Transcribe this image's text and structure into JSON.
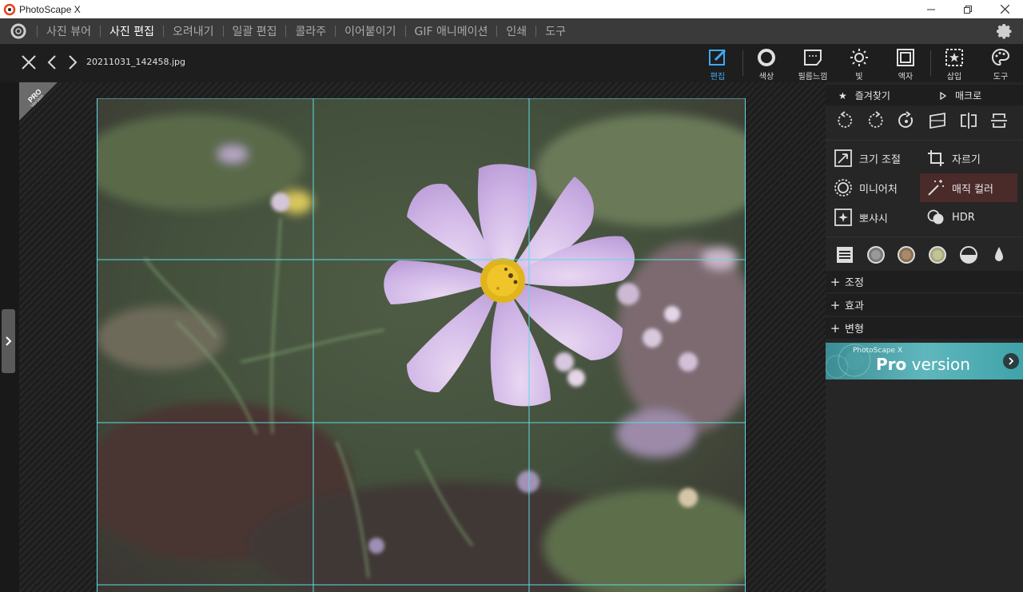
{
  "window": {
    "title": "PhotoScape X"
  },
  "menu": {
    "items": [
      "사진 뷰어",
      "사진 편집",
      "오려내기",
      "일괄 편집",
      "콜라주",
      "이어붙이기",
      "GIF 애니메이션",
      "인쇄",
      "도구"
    ],
    "active_index": 1
  },
  "toolbar": {
    "filename": "20211031_142458.jpg",
    "tools": [
      {
        "label": "편집",
        "icon": "edit-icon",
        "active": true
      },
      {
        "label": "색상",
        "icon": "color-circle-icon"
      },
      {
        "label": "필름느낌",
        "icon": "film-icon"
      },
      {
        "label": "빛",
        "icon": "sun-icon"
      },
      {
        "label": "액자",
        "icon": "frame-icon"
      },
      {
        "label": "삽입",
        "icon": "insert-star-icon"
      },
      {
        "label": "도구",
        "icon": "palette-icon"
      }
    ]
  },
  "canvas": {
    "pro_badge": "PRO",
    "pro_badge_sub": "Version",
    "grid_color": "#5fd9e6"
  },
  "panel": {
    "favorites_label": "즐겨찾기",
    "macro_label": "매크로",
    "transform_icons": [
      "rotate-left-icon",
      "rotate-right-icon",
      "rotate-free-icon",
      "straighten-icon",
      "flip-horizontal-icon",
      "flip-vertical-icon"
    ],
    "features": [
      {
        "label": "크기 조절",
        "icon": "resize-icon"
      },
      {
        "label": "자르기",
        "icon": "crop-icon"
      },
      {
        "label": "미니어처",
        "icon": "miniature-icon"
      },
      {
        "label": "매직 컬러",
        "icon": "magic-wand-icon",
        "highlight": true
      },
      {
        "label": "뽀샤시",
        "icon": "bloom-icon"
      },
      {
        "label": "HDR",
        "icon": "hdr-icon"
      }
    ],
    "filter_icons": [
      "list-icon",
      "filter-gray-icon",
      "filter-sepia-icon",
      "filter-green-icon",
      "filter-half-icon",
      "drop-icon"
    ],
    "sections": [
      "조정",
      "효과",
      "변형"
    ],
    "pro_banner": {
      "small": "PhotoScape X",
      "big_bold": "Pro",
      "big_rest": " version"
    }
  },
  "colors": {
    "accent_blue": "#3fa9f5",
    "menubar_bg": "#3a3a3a",
    "panel_bg": "#262626"
  }
}
